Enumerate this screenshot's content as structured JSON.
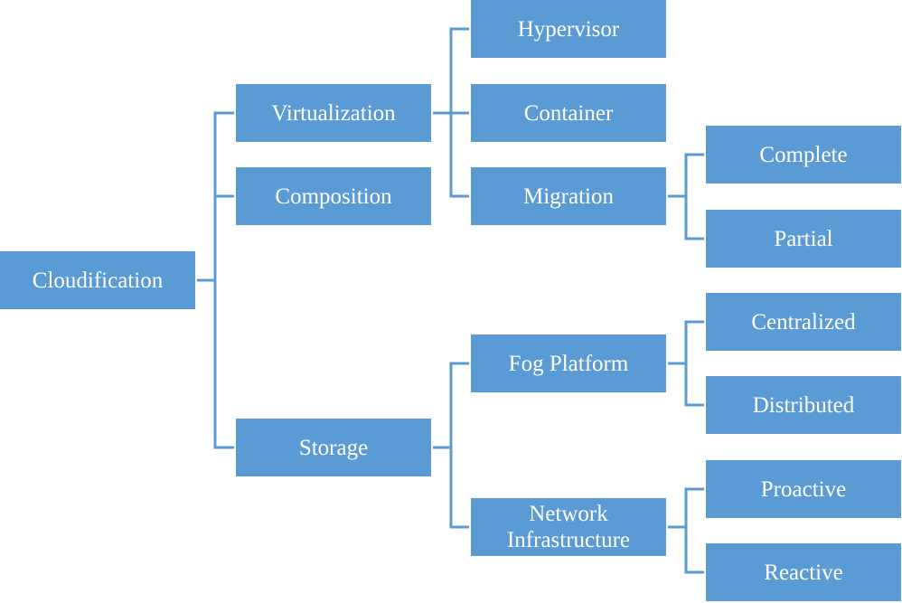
{
  "colors": {
    "node_fill": "#5b9bd5",
    "connector": "#5b9bd5",
    "text": "#ffffff"
  },
  "tree": {
    "label": "Cloudification",
    "children": [
      {
        "label": "Virtualization",
        "children": [
          {
            "label": "Hypervisor"
          },
          {
            "label": "Container"
          },
          {
            "label": "Migration",
            "children": [
              {
                "label": "Complete"
              },
              {
                "label": "Partial"
              }
            ]
          }
        ]
      },
      {
        "label": "Composition"
      },
      {
        "label": "Storage",
        "children": [
          {
            "label": "Fog Platform",
            "children": [
              {
                "label": "Centralized"
              },
              {
                "label": "Distributed"
              }
            ]
          },
          {
            "label": "Network Infrastructure",
            "children": [
              {
                "label": "Proactive"
              },
              {
                "label": "Reactive"
              }
            ]
          }
        ]
      }
    ]
  }
}
